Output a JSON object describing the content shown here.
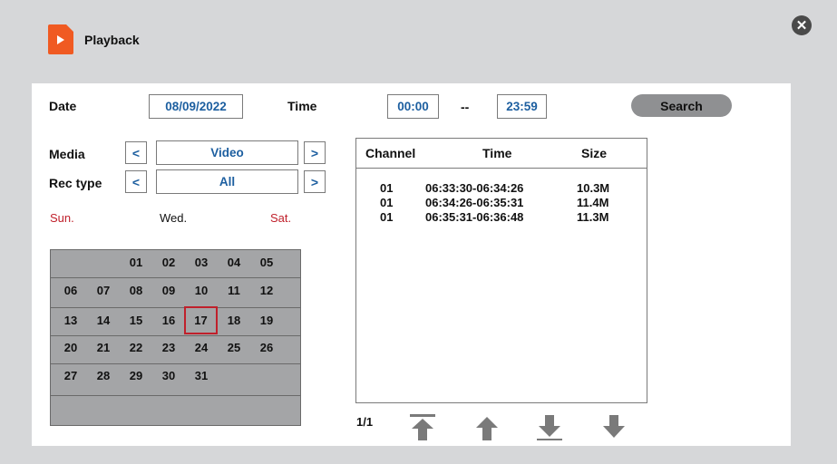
{
  "header": {
    "title": "Playback"
  },
  "icons": {
    "header": "playback-file-icon",
    "close": "close-icon"
  },
  "colors": {
    "accent": "#f05a22",
    "value_text": "#1d5fa0",
    "weekend": "#c0202b",
    "selected_day_border": "#c0202b"
  },
  "search_row": {
    "date_label": "Date",
    "date_value": "08/09/2022",
    "time_label": "Time",
    "time_start": "00:00",
    "time_separator": "--",
    "time_end": "23:59",
    "search_label": "Search"
  },
  "filters": {
    "media_label": "Media",
    "media_value": "Video",
    "rec_type_label": "Rec type",
    "rec_type_value": "All",
    "prev_symbol": "<",
    "next_symbol": ">"
  },
  "calendar": {
    "week_header": {
      "sun": "Sun.",
      "wed": "Wed.",
      "sat": "Sat."
    },
    "weeks": [
      [
        "",
        "",
        "01",
        "02",
        "03",
        "04",
        "05"
      ],
      [
        "06",
        "07",
        "08",
        "09",
        "10",
        "11",
        "12"
      ],
      [
        "13",
        "14",
        "15",
        "16",
        "17",
        "18",
        "19"
      ],
      [
        "20",
        "21",
        "22",
        "23",
        "24",
        "25",
        "26"
      ],
      [
        "27",
        "28",
        "29",
        "30",
        "31",
        "",
        ""
      ]
    ],
    "selected_day": "17"
  },
  "records": {
    "columns": {
      "channel": "Channel",
      "time": "Time",
      "size": "Size"
    },
    "rows": [
      {
        "channel": "01",
        "time": "06:33:30-06:34:26",
        "size": "10.3M"
      },
      {
        "channel": "01",
        "time": "06:34:26-06:35:31",
        "size": "11.4M"
      },
      {
        "channel": "01",
        "time": "06:35:31-06:36:48",
        "size": "11.3M"
      }
    ]
  },
  "pager": {
    "indicator": "1/1"
  }
}
